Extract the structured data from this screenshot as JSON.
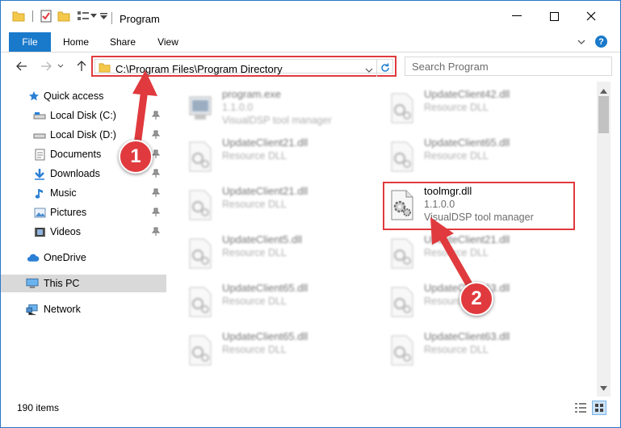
{
  "window": {
    "title": "Program"
  },
  "ribbon": {
    "tabs": [
      "File",
      "Home",
      "Share",
      "View"
    ]
  },
  "address": {
    "path": "C:\\Program Files\\Program Directory"
  },
  "search": {
    "placeholder": "Search Program"
  },
  "sidebar": {
    "items": [
      {
        "label": "Quick access",
        "icon": "star-icon",
        "pinned": false
      },
      {
        "label": "Local Disk (C:)",
        "icon": "drive-icon",
        "pinned": true
      },
      {
        "label": "Local Disk (D:)",
        "icon": "drive-icon",
        "pinned": true
      },
      {
        "label": "Documents",
        "icon": "documents-icon",
        "pinned": true
      },
      {
        "label": "Downloads",
        "icon": "download-icon",
        "pinned": true
      },
      {
        "label": "Music",
        "icon": "music-icon",
        "pinned": true
      },
      {
        "label": "Pictures",
        "icon": "pictures-icon",
        "pinned": true
      },
      {
        "label": "Videos",
        "icon": "videos-icon",
        "pinned": true
      },
      {
        "label": "OneDrive",
        "icon": "cloud-icon",
        "pinned": false
      },
      {
        "label": "This PC",
        "icon": "computer-icon",
        "pinned": false
      },
      {
        "label": "Network",
        "icon": "network-icon",
        "pinned": false
      }
    ]
  },
  "files": {
    "left": [
      {
        "name": "program.exe",
        "line2": "1.1.0.0",
        "line3": "VisualDSP tool manager"
      },
      {
        "name": "UpdateClient21.dll",
        "line2": "Resource DLL"
      },
      {
        "name": "UpdateClient21.dll",
        "line2": "Resource DLL"
      },
      {
        "name": "UpdateClient5.dll",
        "line2": "Resource DLL"
      },
      {
        "name": "UpdateClient65.dll",
        "line2": "Resource DLL"
      },
      {
        "name": "UpdateClient65.dll",
        "line2": "Resource DLL"
      }
    ],
    "right": [
      {
        "name": "UpdateClient42.dll",
        "line2": "Resource DLL"
      },
      {
        "name": "UpdateClient65.dll",
        "line2": "Resource DLL"
      },
      {
        "name": "UpdateClient21.dll",
        "line2": "Resource DLL"
      },
      {
        "name": "UpdateClient63.dll",
        "line2": "Resource DLL"
      },
      {
        "name": "UpdateClient63.dll",
        "line2": "Resource DLL"
      }
    ],
    "target": {
      "name": "toolmgr.dll",
      "version": "1.1.0.0",
      "description": "VisualDSP tool manager"
    }
  },
  "status": {
    "item_count": "190 items"
  },
  "annotations": {
    "step1": "1",
    "step2": "2"
  },
  "colors": {
    "accent": "#1979ca",
    "highlight": "#e03a3e"
  }
}
